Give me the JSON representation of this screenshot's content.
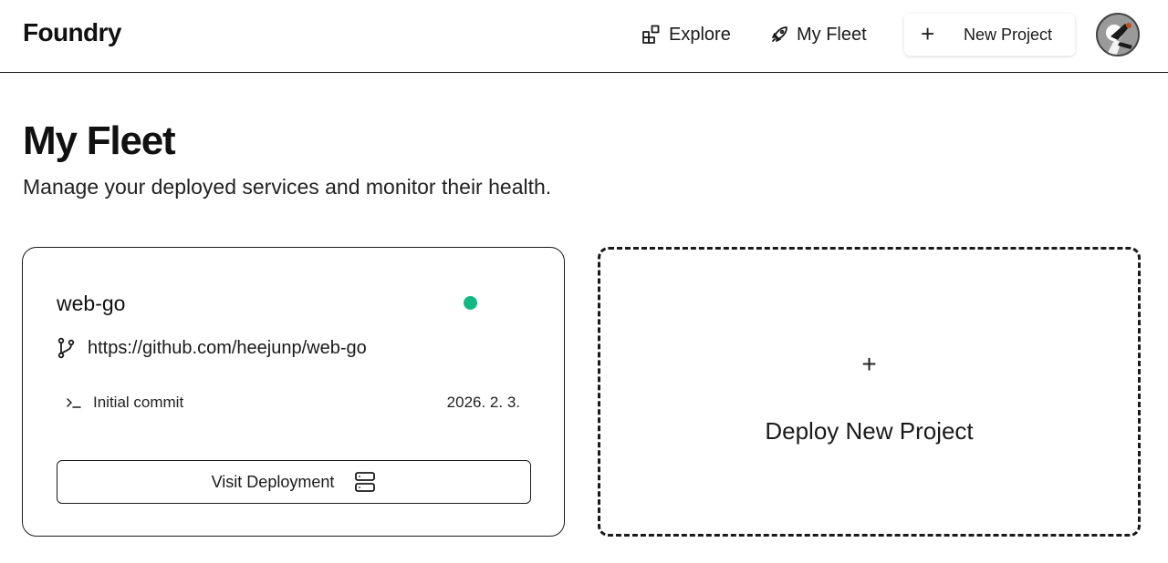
{
  "header": {
    "brand": "Foundry",
    "nav": [
      {
        "label": "Explore",
        "icon": "grid-icon"
      },
      {
        "label": "My Fleet",
        "icon": "rocket-icon"
      }
    ],
    "new_project_label": "New Project",
    "avatar_icon": "avatar"
  },
  "page": {
    "title": "My Fleet",
    "subtitle": "Manage your deployed services and monitor their health."
  },
  "projects": [
    {
      "name": "web-go",
      "status_color": "#10b981",
      "repo_url": "https://github.com/heejunp/web-go",
      "commit_message": "Initial commit",
      "commit_date": "2026. 2. 3.",
      "visit_label": "Visit Deployment"
    }
  ],
  "deploy_card": {
    "plus": "+",
    "label": "Deploy New Project"
  }
}
